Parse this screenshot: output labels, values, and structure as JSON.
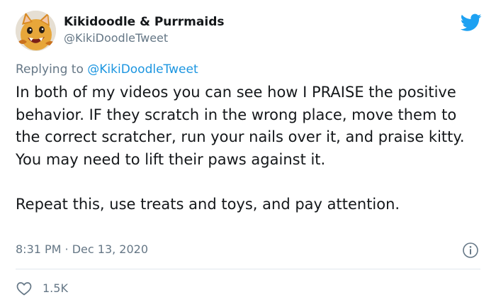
{
  "tweet": {
    "author": {
      "display_name": "Kikidoodle & Purrmaids",
      "handle": "@KikiDoodleTweet",
      "avatar_icon": "cat-avatar-icon"
    },
    "platform_icon": "twitter-bird-icon",
    "reply": {
      "prefix": "Replying to",
      "mention": "@KikiDoodleTweet"
    },
    "body": {
      "paragraph_1": "In both of my videos you can see how I PRAISE the positive behavior. IF they scratch in the wrong place, move them to the correct scratcher, run your nails over it, and praise kitty. You may need to lift their paws against it.",
      "paragraph_2": "Repeat this, use treats and toys, and pay attention."
    },
    "timestamp": "8:31 PM · Dec 13, 2020",
    "info_icon": "info-icon",
    "likes": {
      "icon": "heart-icon",
      "count": "1.5K"
    }
  },
  "colors": {
    "text_primary": "#14171a",
    "text_secondary": "#657786",
    "link_blue": "#1b95e0",
    "twitter_blue": "#1da1f2",
    "divider": "#e1e8ed"
  }
}
